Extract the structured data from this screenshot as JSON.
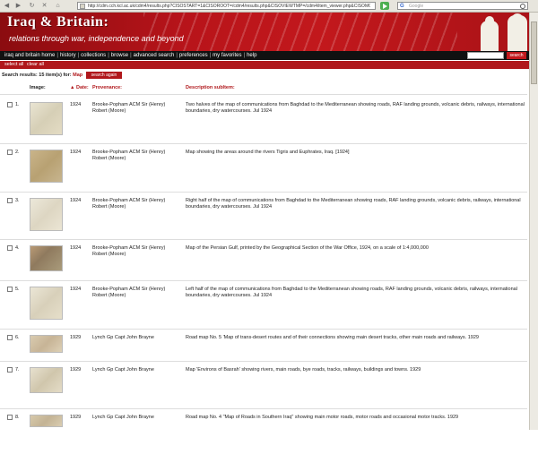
{
  "browser": {
    "url": "http://cdm.cch.kcl.ac.uk/cdm4/results.php?CISOSTART=1&CISOROOT=/cdm4/results.php&CISOVIEWTMP=/cdm4/item_viewer.php&CISOMODE=grid&CISOGRID",
    "search_placeholder": "Google"
  },
  "header": {
    "title": "Iraq & Britain:",
    "subtitle": "relations through war, independence and beyond"
  },
  "nav": {
    "items": [
      "iraq and britain home",
      "history",
      "collections",
      "browse",
      "advanced search",
      "preferences",
      "my favorites",
      "help"
    ],
    "search_button": "search"
  },
  "selectbar": {
    "select_all": "select all",
    "clear_all": "clear all"
  },
  "results": {
    "info_prefix": "Search results: 15 item(s) for:",
    "info_term": "Map",
    "search_again": "search again"
  },
  "columns": {
    "image": "Image:",
    "date": "▲ Date:",
    "provenance": "Provenance:",
    "description": "Description subItem:"
  },
  "rows": [
    {
      "num": "1.",
      "date": "1924",
      "prov": "Brooke-Popham ACM Sir (Henry) Robert (Moore)",
      "desc": "Two halves of the map of communications from Baghdad to the Mediterranean showing roads, RAF landing grounds, volcanic debris, railways, international boundaries, dry watercourses. Jul 1924"
    },
    {
      "num": "2.",
      "date": "1924",
      "prov": "Brooke-Popham ACM Sir (Henry) Robert (Moore)",
      "desc": "Map showing the areas around the rivers Tigris and Euphrates, Iraq. [1924]"
    },
    {
      "num": "3.",
      "date": "1924",
      "prov": "Brooke-Popham ACM Sir (Henry) Robert (Moore)",
      "desc": "Right half of the map of communications from Baghdad to the Mediterranean showing roads, RAF landing grounds, volcanic debris, railways, international boundaries, dry watercourses. Jul 1924"
    },
    {
      "num": "4.",
      "date": "1924",
      "prov": "Brooke-Popham ACM Sir (Henry) Robert (Moore)",
      "desc": "Map of the Persian Gulf, printed by the Geographical Section of the War Office, 1924, on a scale of 1:4,000,000"
    },
    {
      "num": "5.",
      "date": "1924",
      "prov": "Brooke-Popham ACM Sir (Henry) Robert (Moore)",
      "desc": "Left half of the map of communications from Baghdad to the Mediterranean showing roads, RAF landing grounds, volcanic debris, railways, international boundaries, dry watercourses. Jul 1924"
    },
    {
      "num": "6.",
      "date": "1929",
      "prov": "Lynch Gp Capt John Brayne",
      "desc": "Road map No. 5 'Map of trans-desert routes and of their connections showing main desert tracks, other main roads and railways. 1929"
    },
    {
      "num": "7.",
      "date": "1929",
      "prov": "Lynch Gp Capt John Brayne",
      "desc": "Map 'Environs of Basrah' showing rivers, main roads, bye roads, tracks, railways, buildings and towns. 1929"
    },
    {
      "num": "8.",
      "date": "1929",
      "prov": "Lynch Gp Capt John Brayne",
      "desc": "Road map No. 4 \"Map of Roads in Southern Iraq\" showing main motor roads, motor roads and occasional motor tracks. 1929"
    }
  ],
  "colors": {
    "brand_red": "#b0171b",
    "banner_red": "#c2181c",
    "menu_black": "#111111"
  }
}
